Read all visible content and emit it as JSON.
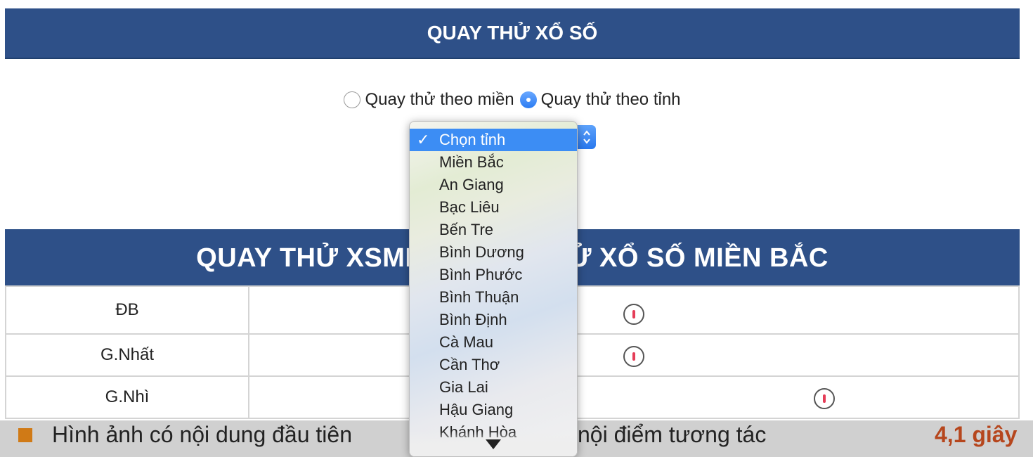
{
  "title": "QUAY THỬ XỔ SỐ",
  "radio_options": [
    {
      "label": "Quay thử theo miền",
      "checked": false
    },
    {
      "label": "Quay thử theo tỉnh",
      "checked": true
    }
  ],
  "province_select": {
    "selected": "Chọn tỉnh",
    "check_mark": "✓",
    "options": [
      "Miền Bắc",
      "An Giang",
      "Bạc Liêu",
      "Bến Tre",
      "Bình Dương",
      "Bình Phước",
      "Bình Thuận",
      "Bình Định",
      "Cà Mau",
      "Cần Thơ",
      "Gia Lai",
      "Hậu Giang",
      "Khánh Hòa"
    ]
  },
  "results_heading": "QUAY THỬ XSMB - QUAY THỬ XỔ SỐ MIỀN BẮC",
  "results_heading_visible_left": "QUAY THỬ XSM",
  "results_heading_visible_right": "Ử XỔ SỐ MIỀN BẮC",
  "prizes": [
    "ĐB",
    "G.Nhất",
    "G.Nhì"
  ],
  "perf_bar": {
    "metric1": "Hình ảnh có nội dung đầu tiên",
    "metric2": "nội điểm tương tác",
    "value": "4,1 giây"
  },
  "colors": {
    "header_bg": "#2e5088",
    "accent": "#3c8df4",
    "value_color": "#b6461d"
  }
}
